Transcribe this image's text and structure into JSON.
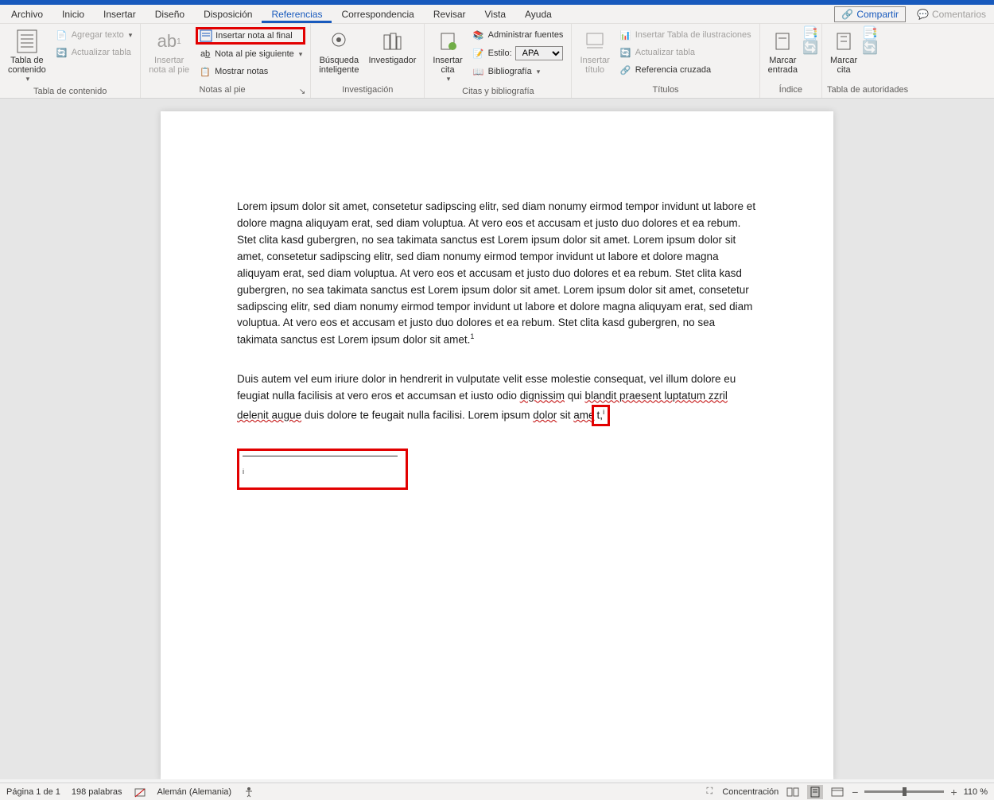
{
  "menubar": {
    "items": [
      "Archivo",
      "Inicio",
      "Insertar",
      "Diseño",
      "Disposición",
      "Referencias",
      "Correspondencia",
      "Revisar",
      "Vista",
      "Ayuda"
    ],
    "active_index": 5,
    "share": "Compartir",
    "comments": "Comentarios"
  },
  "ribbon": {
    "groups": {
      "toc": {
        "label": "Tabla de contenido",
        "main": "Tabla de\ncontenido",
        "add_text": "Agregar texto",
        "update_table": "Actualizar tabla"
      },
      "footnotes": {
        "label": "Notas al pie",
        "insert_footnote": "Insertar\nnota al pie",
        "ab_label": "ab",
        "insert_endnote": "Insertar nota al final",
        "next_footnote": "Nota al pie siguiente",
        "show_notes": "Mostrar notas"
      },
      "research": {
        "label": "Investigación",
        "smart_lookup": "Búsqueda\ninteligente",
        "researcher": "Investigador"
      },
      "citations": {
        "label": "Citas y bibliografía",
        "insert_citation": "Insertar\ncita",
        "manage_sources": "Administrar fuentes",
        "style_label": "Estilo:",
        "style_value": "APA",
        "bibliography": "Bibliografía"
      },
      "captions": {
        "label": "Títulos",
        "insert_caption": "Insertar\ntítulo",
        "insert_tof": "Insertar Tabla de ilustraciones",
        "update_table": "Actualizar tabla",
        "cross_reference": "Referencia cruzada"
      },
      "index": {
        "label": "Índice",
        "mark_entry": "Marcar\nentrada"
      },
      "authorities": {
        "label": "Tabla de autoridades",
        "mark_citation": "Marcar\ncita"
      }
    }
  },
  "document": {
    "para1": "Lorem ipsum dolor sit amet, consetetur sadipscing elitr, sed diam nonumy eirmod tempor invidunt ut labore et dolore magna aliquyam erat, sed diam voluptua. At vero eos et accusam et justo duo dolores et ea rebum. Stet clita kasd gubergren, no sea takimata sanctus est Lorem ipsum dolor sit amet. Lorem ipsum dolor sit amet, consetetur sadipscing elitr, sed diam nonumy eirmod tempor invidunt ut labore et dolore magna aliquyam erat, sed diam voluptua. At vero eos et accusam et justo duo dolores et ea rebum. Stet clita kasd gubergren, no sea takimata sanctus est Lorem ipsum dolor sit amet. Lorem ipsum dolor sit amet, consetetur sadipscing elitr, sed diam nonumy eirmod tempor invidunt ut labore et dolore magna aliquyam erat, sed diam voluptua. At vero eos et accusam et justo duo dolores et ea rebum. Stet clita kasd gubergren, no sea takimata sanctus est Lorem ipsum dolor sit amet.",
    "footnote_ref": "1",
    "para2_a": "Duis autem vel eum iriure dolor in hendrerit in vulputate velit esse molestie consequat, vel illum dolore eu feugiat nulla facilisis at vero eros et accumsan et iusto odio ",
    "para2_b": "dignissim",
    "para2_c": " qui ",
    "para2_d": "blandit praesent luptatum zzril delenit augue",
    "para2_e": " duis dolore te feugait nulla facilisi. Lorem ipsum ",
    "para2_f": "dolor",
    "para2_g": " sit ",
    "para2_h": "ame",
    "para2_i": "t,",
    "endnote_ref": "i",
    "endnote_cursor": "i"
  },
  "statusbar": {
    "page": "Página 1 de 1",
    "words": "198 palabras",
    "language": "Alemán (Alemania)",
    "focus": "Concentración",
    "zoom": "110 %"
  }
}
